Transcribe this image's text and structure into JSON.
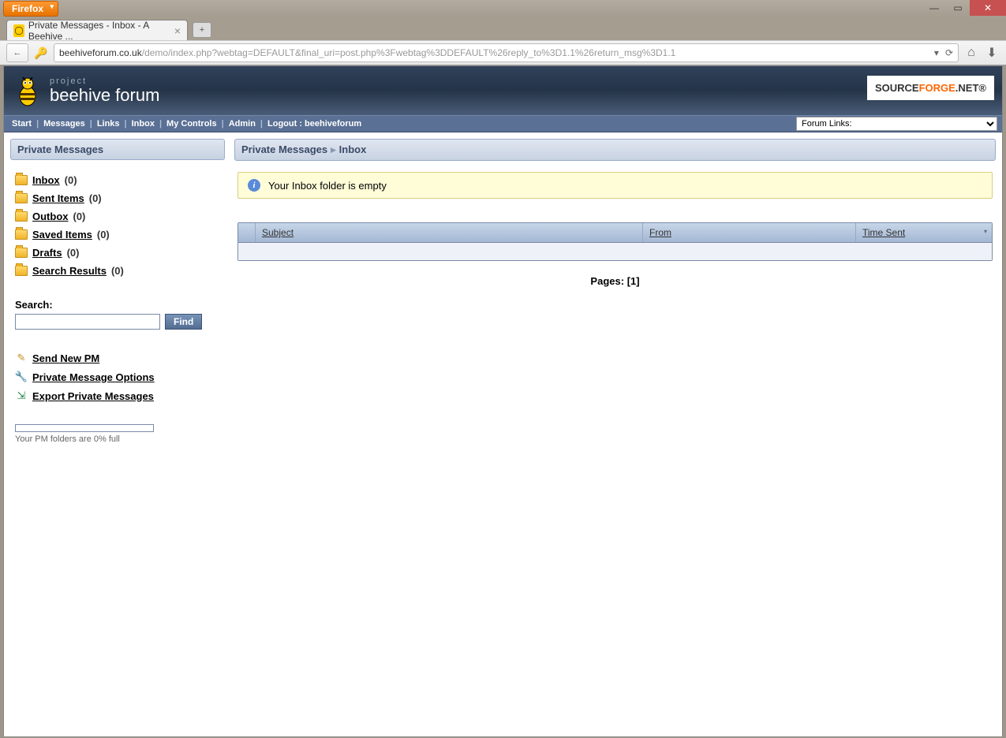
{
  "browser": {
    "firefox_label": "Firefox",
    "tab_title": "Private Messages - Inbox - A Beehive ...",
    "url_domain": "beehiveforum.co.uk",
    "url_path": "/demo/index.php?webtag=DEFAULT&final_uri=post.php%3Fwebtag%3DDEFAULT%26reply_to%3D1.1%26return_msg%3D1.1"
  },
  "header": {
    "project": "project",
    "name": "beehive forum",
    "sponsor_pre": "SOURCE",
    "sponsor_mid": "FORGE",
    "sponsor_suf": ".NET®"
  },
  "nav": {
    "items": [
      "Start",
      "Messages",
      "Links",
      "Inbox",
      "My Controls",
      "Admin",
      "Logout : beehiveforum"
    ],
    "forum_links": "Forum Links:"
  },
  "sidebar": {
    "heading": "Private Messages",
    "folders": [
      {
        "label": "Inbox",
        "count": "(0)"
      },
      {
        "label": "Sent Items",
        "count": "(0)"
      },
      {
        "label": "Outbox",
        "count": "(0)"
      },
      {
        "label": "Saved Items",
        "count": "(0)"
      },
      {
        "label": "Drafts",
        "count": "(0)"
      },
      {
        "label": "Search Results",
        "count": "(0)"
      }
    ],
    "search_label": "Search:",
    "find_label": "Find",
    "actions": {
      "send": "Send New PM",
      "options": "Private Message Options",
      "export": "Export Private Messages"
    },
    "quota": "Your PM folders are 0% full"
  },
  "main": {
    "crumb1": "Private Messages",
    "crumb2": "Inbox",
    "notice": "Your Inbox folder is empty",
    "cols": {
      "subject": "Subject",
      "from": "From",
      "time": "Time Sent"
    },
    "pages_label": "Pages:",
    "pages_current": "[1]"
  }
}
